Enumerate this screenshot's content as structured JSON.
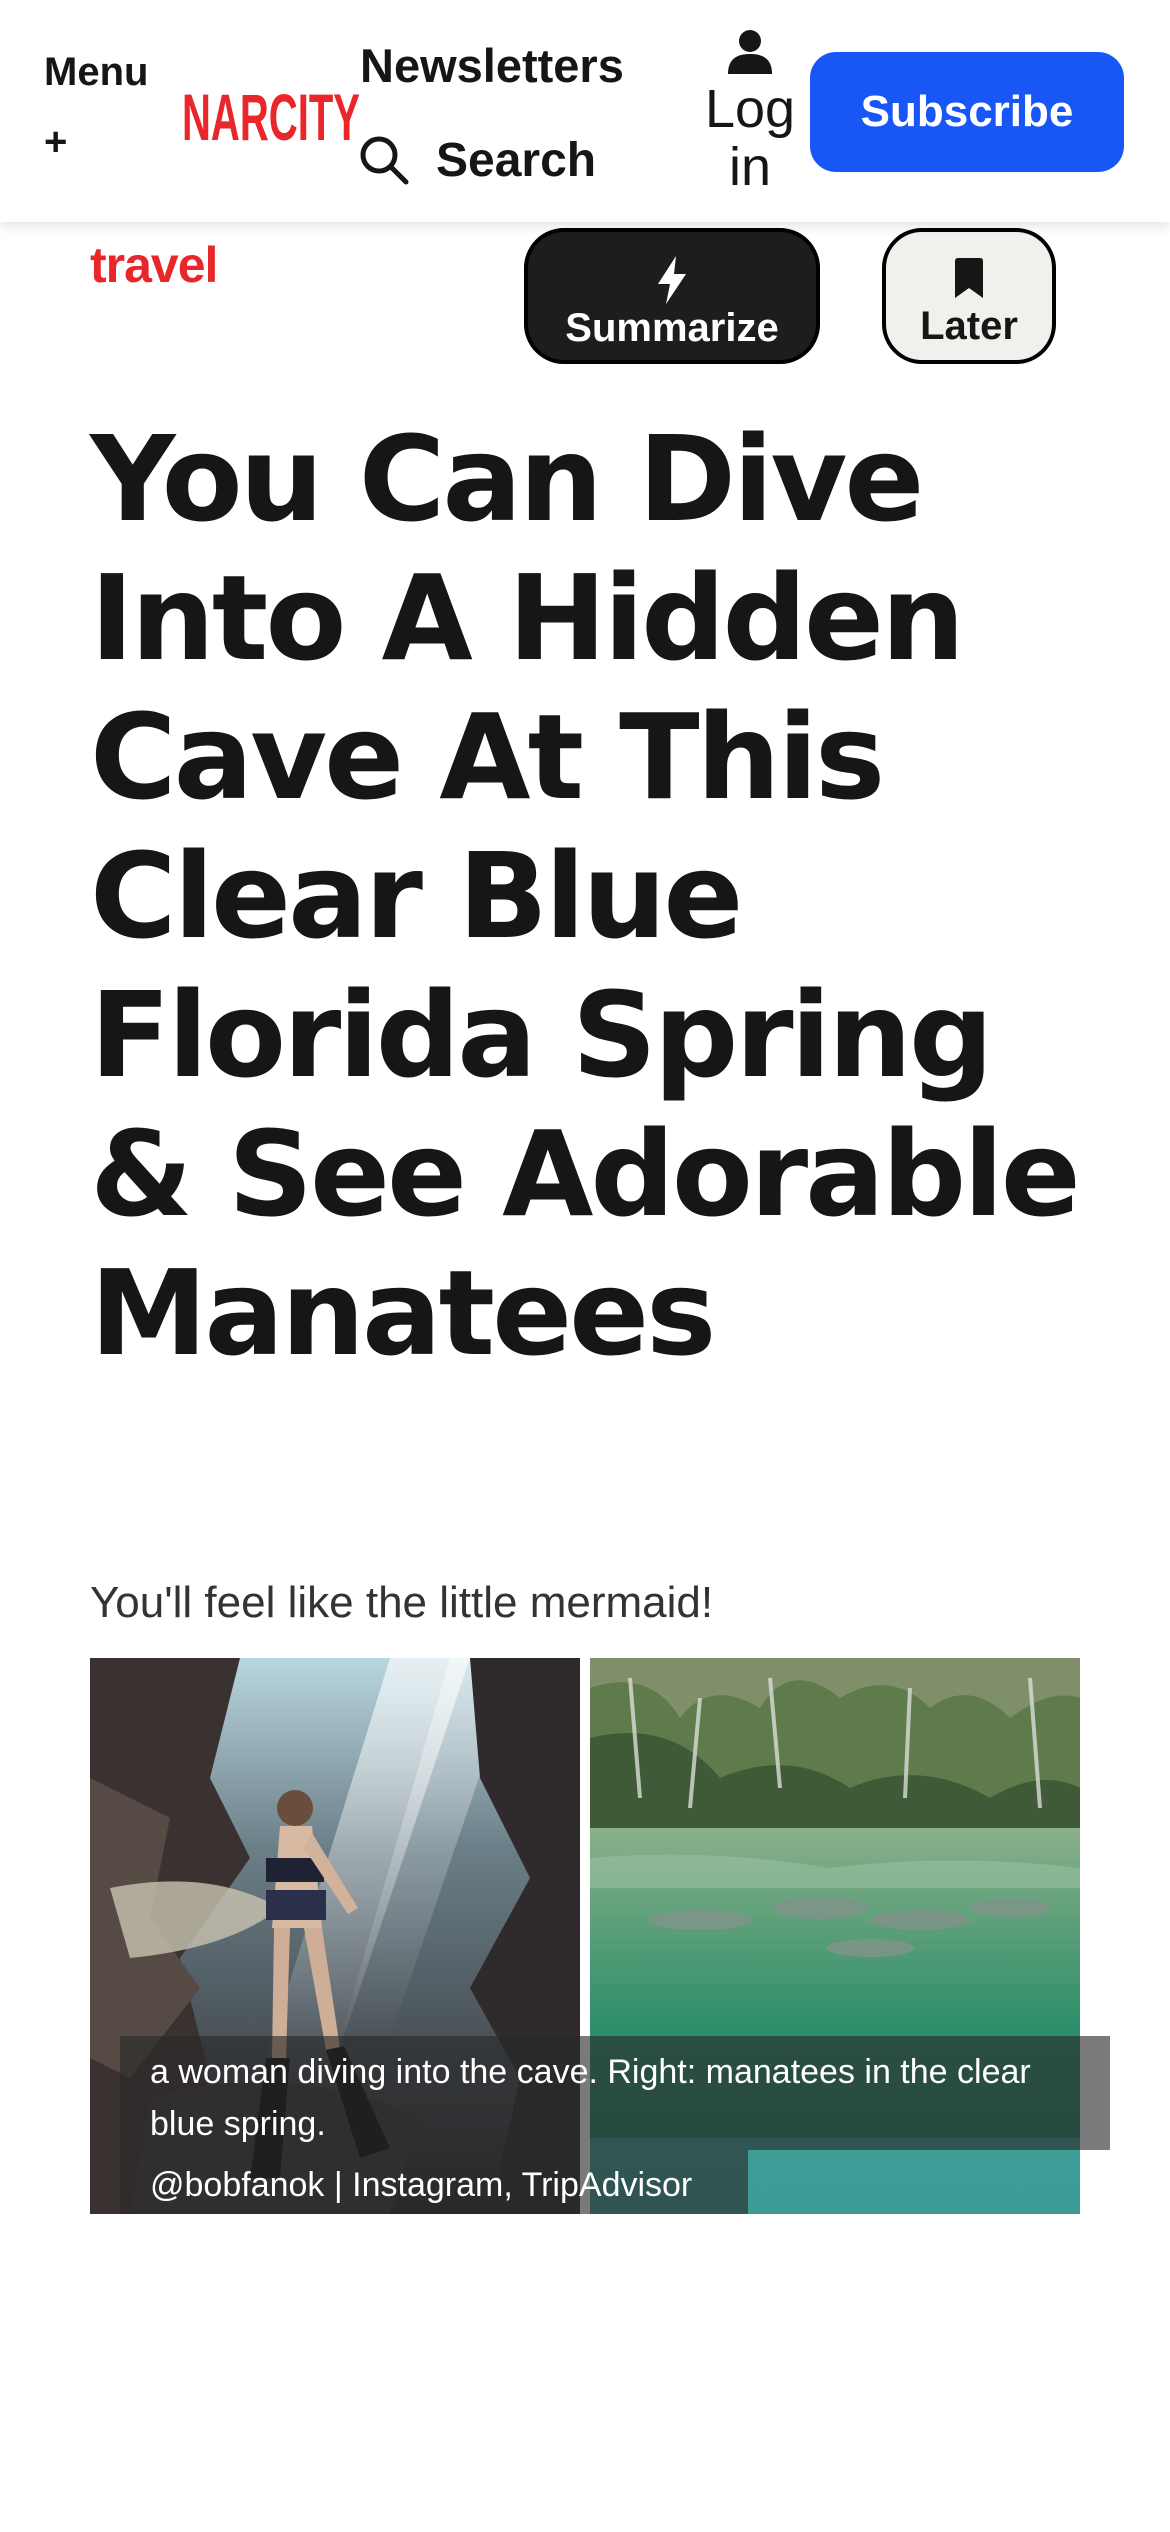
{
  "header": {
    "menu_label": "Menu",
    "menu_plus": "+",
    "logo_text": "NARCITY",
    "newsletters_label": "Newsletters",
    "search_label": "Search",
    "login_label": "Log in",
    "subscribe_label": "Subscribe"
  },
  "article": {
    "category": "travel",
    "summarize_label": "Summarize",
    "later_label": "Later",
    "headline": "You Can Dive Into A Hidden Cave At This Clear Blue Florida Spring & See Adorable Manatees",
    "subtitle": "You'll feel like the little mermaid!",
    "caption": "a woman diving into the cave. Right: manatees in the clear blue spring.",
    "credit": "@bobfanok | Instagram, TripAdvisor"
  },
  "colors": {
    "brand_red": "#e9262a",
    "subscribe_blue": "#1857f5",
    "text_dark": "#161616"
  },
  "icons": [
    "search-icon",
    "user-icon",
    "lightning-icon",
    "bookmark-icon"
  ]
}
